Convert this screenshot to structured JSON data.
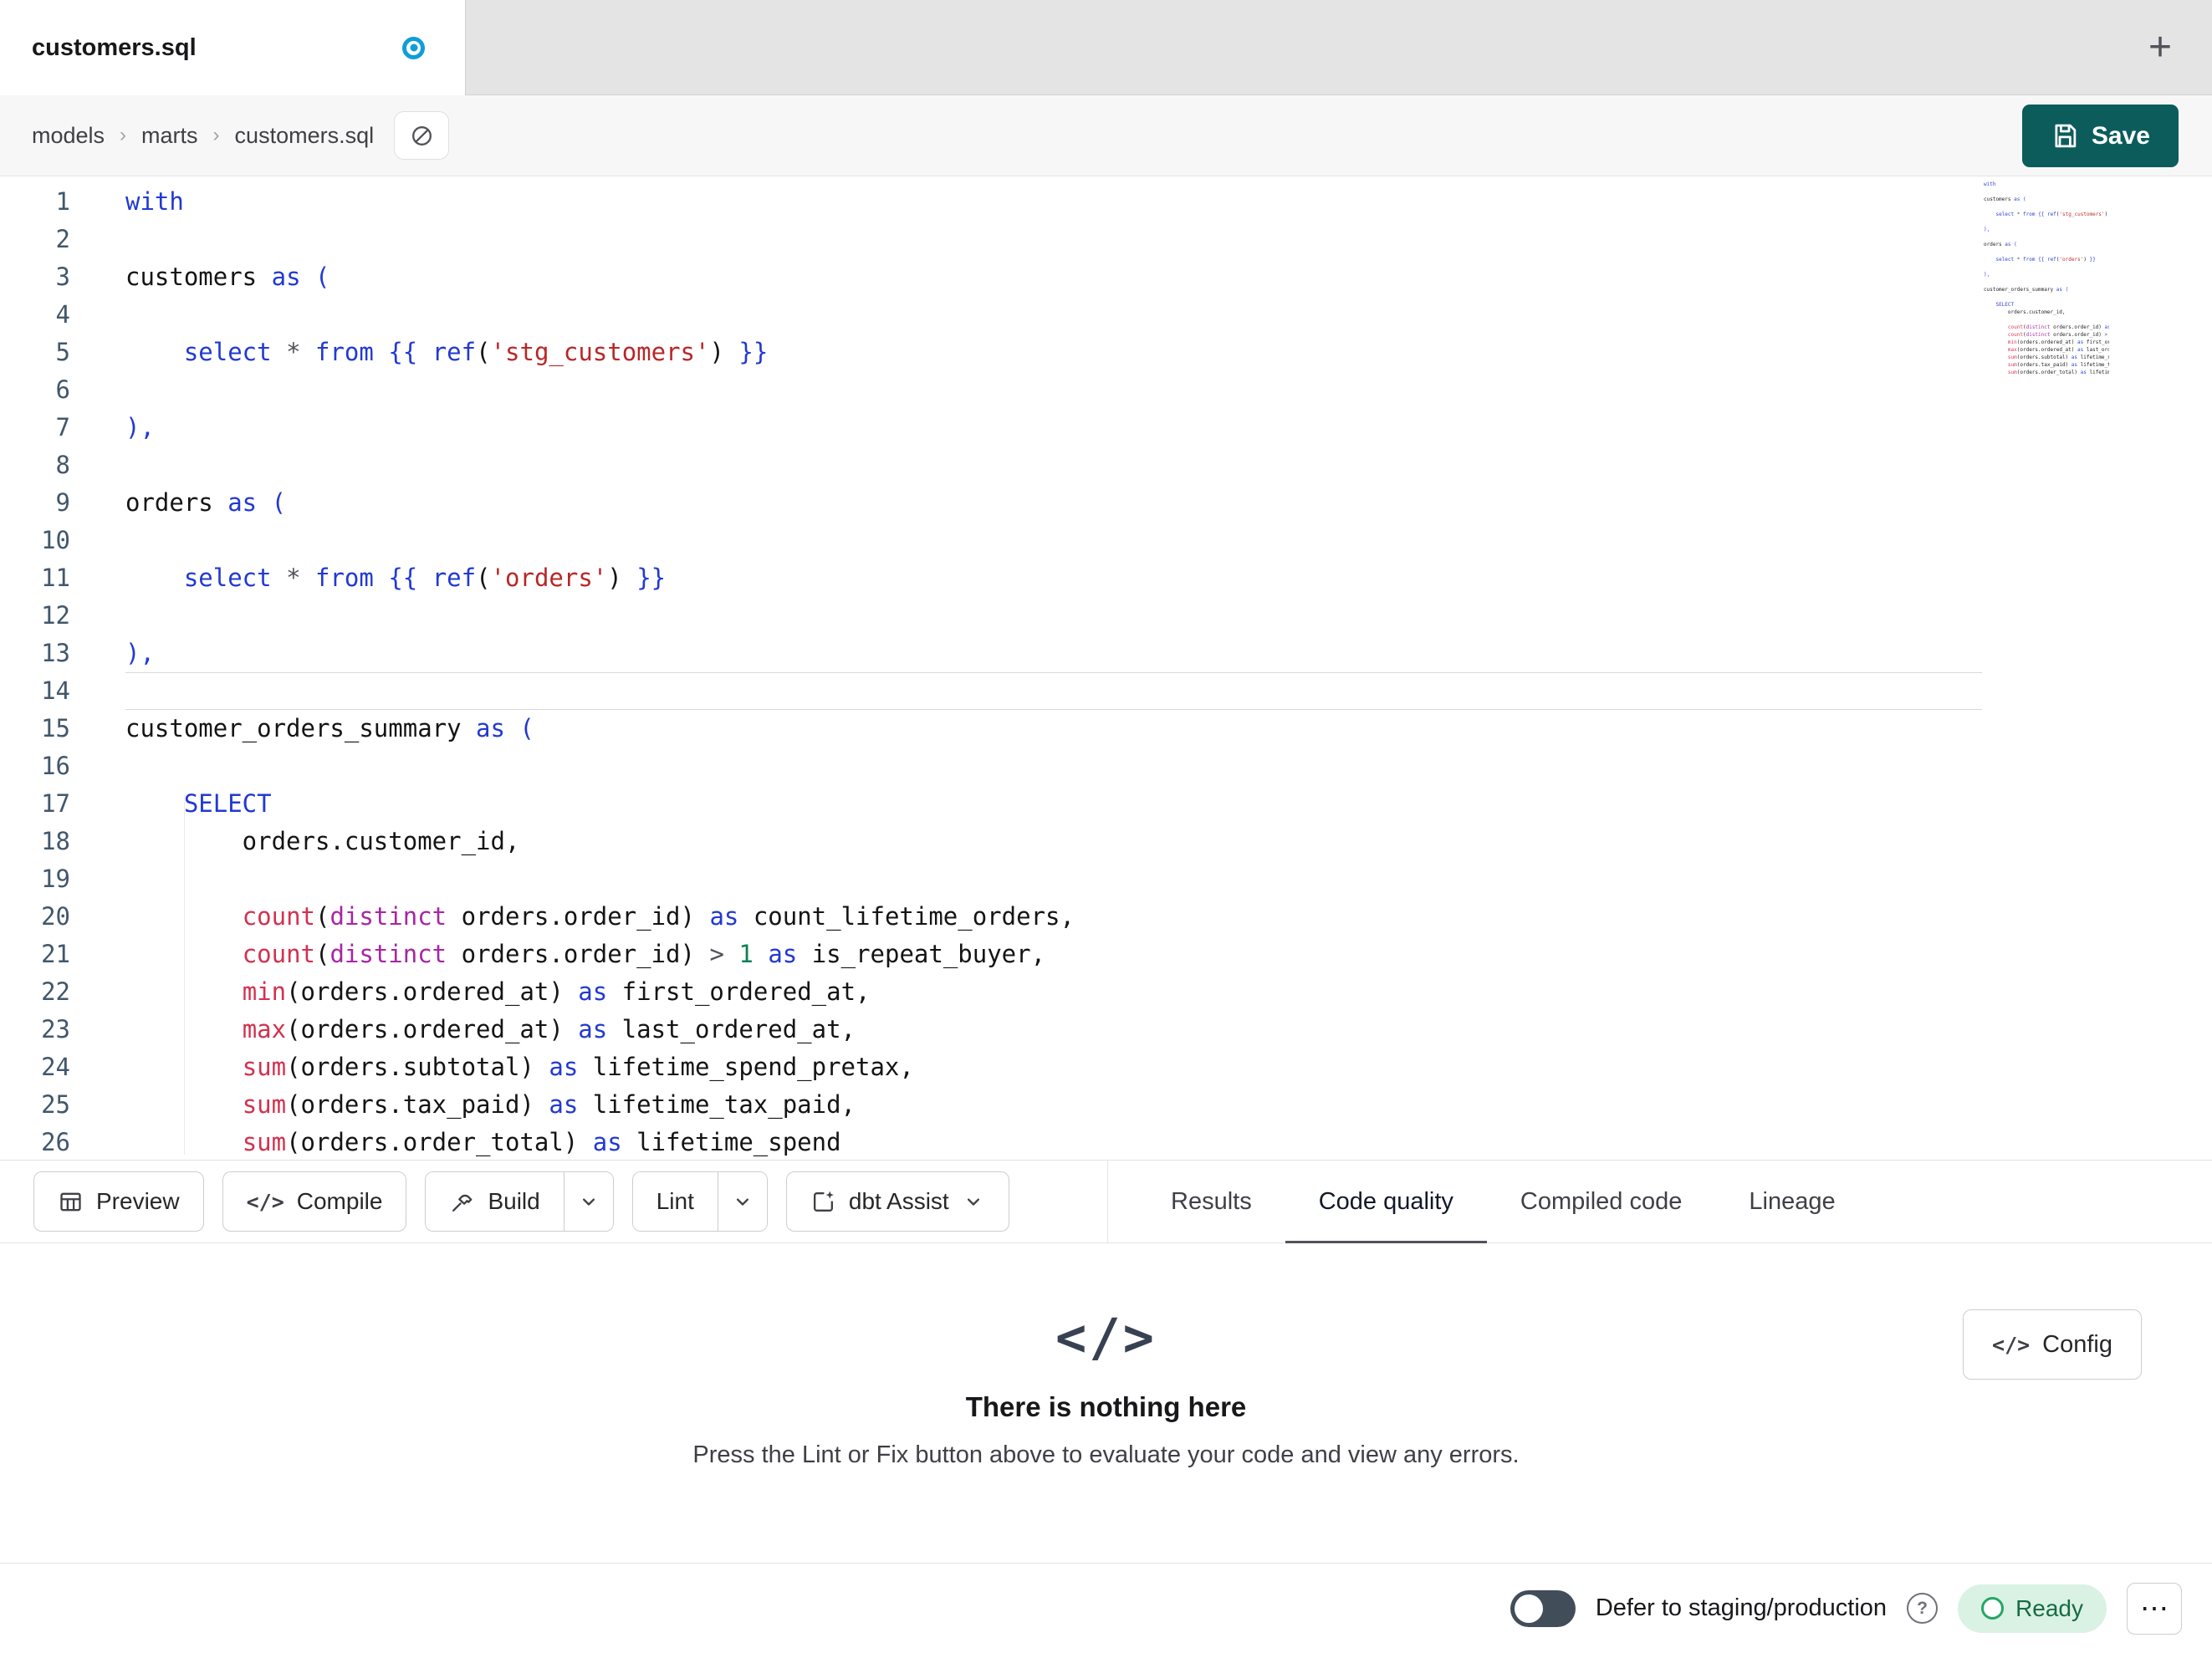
{
  "colors": {
    "kw": "#2239d2",
    "str": "#b82727",
    "fn": "#d23150",
    "kw2": "#a626a4",
    "num": "#0e8157",
    "op": "#52525b",
    "pl": "#141414",
    "lineno": "#41576b",
    "dot": "#0f9ed8",
    "save": "#0d5c5c",
    "ready-bg": "#d9f2e4",
    "ready-fg": "#186b43",
    "ready-ring": "#27a567",
    "toggle": "#414d59",
    "underline": "#52525b"
  },
  "tabbar": {
    "tab_label": "customers.sql",
    "new_tab": "+"
  },
  "breadcrumb": {
    "items": [
      "models",
      "marts",
      "customers.sql"
    ],
    "separator": "›"
  },
  "save": {
    "label": "Save"
  },
  "icons": {
    "code_glyph": "</>"
  },
  "editor": {
    "current_line": 14,
    "lines": [
      [
        [
          "with",
          "kw"
        ]
      ],
      [],
      [
        [
          "customers ",
          "pl"
        ],
        [
          "as",
          "kw"
        ],
        [
          " ",
          "pl"
        ],
        [
          "(",
          "kw"
        ]
      ],
      [],
      [
        [
          "    ",
          "pl"
        ],
        [
          "select",
          "kw"
        ],
        [
          " ",
          "pl"
        ],
        [
          "*",
          "op"
        ],
        [
          " ",
          "pl"
        ],
        [
          "from",
          "kw"
        ],
        [
          " ",
          "pl"
        ],
        [
          "{{",
          "kw"
        ],
        [
          " ",
          "pl"
        ],
        [
          "ref",
          "kw"
        ],
        [
          "(",
          "pl"
        ],
        [
          "'stg_customers'",
          "str"
        ],
        [
          ")",
          "pl"
        ],
        [
          " ",
          "pl"
        ],
        [
          "}}",
          "kw"
        ]
      ],
      [],
      [
        [
          "),",
          "kw"
        ]
      ],
      [],
      [
        [
          "orders ",
          "pl"
        ],
        [
          "as",
          "kw"
        ],
        [
          " ",
          "pl"
        ],
        [
          "(",
          "kw"
        ]
      ],
      [],
      [
        [
          "    ",
          "pl"
        ],
        [
          "select",
          "kw"
        ],
        [
          " ",
          "pl"
        ],
        [
          "*",
          "op"
        ],
        [
          " ",
          "pl"
        ],
        [
          "from",
          "kw"
        ],
        [
          " ",
          "pl"
        ],
        [
          "{{",
          "kw"
        ],
        [
          " ",
          "pl"
        ],
        [
          "ref",
          "kw"
        ],
        [
          "(",
          "pl"
        ],
        [
          "'orders'",
          "str"
        ],
        [
          ")",
          "pl"
        ],
        [
          " ",
          "pl"
        ],
        [
          "}}",
          "kw"
        ]
      ],
      [],
      [
        [
          "),",
          "kw"
        ]
      ],
      [],
      [
        [
          "customer_orders_summary ",
          "pl"
        ],
        [
          "as",
          "kw"
        ],
        [
          " ",
          "pl"
        ],
        [
          "(",
          "kw"
        ]
      ],
      [],
      [
        [
          "    ",
          "pl"
        ],
        [
          "SELECT",
          "kw"
        ]
      ],
      [
        [
          "        orders.customer_id,",
          "pl"
        ]
      ],
      [],
      [
        [
          "        ",
          "pl"
        ],
        [
          "count",
          "fn"
        ],
        [
          "(",
          "pl"
        ],
        [
          "distinct",
          "kw2"
        ],
        [
          " orders.order_id",
          "pl"
        ],
        [
          ")",
          "pl"
        ],
        [
          " ",
          "pl"
        ],
        [
          "as",
          "kw"
        ],
        [
          " count_lifetime_orders,",
          "pl"
        ]
      ],
      [
        [
          "        ",
          "pl"
        ],
        [
          "count",
          "fn"
        ],
        [
          "(",
          "pl"
        ],
        [
          "distinct",
          "kw2"
        ],
        [
          " orders.order_id",
          "pl"
        ],
        [
          ")",
          "pl"
        ],
        [
          " ",
          "pl"
        ],
        [
          ">",
          "op"
        ],
        [
          " ",
          "pl"
        ],
        [
          "1",
          "num"
        ],
        [
          " ",
          "pl"
        ],
        [
          "as",
          "kw"
        ],
        [
          " is_repeat_buyer,",
          "pl"
        ]
      ],
      [
        [
          "        ",
          "pl"
        ],
        [
          "min",
          "fn"
        ],
        [
          "(",
          "pl"
        ],
        [
          "orders.ordered_at",
          "pl"
        ],
        [
          ")",
          "pl"
        ],
        [
          " ",
          "pl"
        ],
        [
          "as",
          "kw"
        ],
        [
          " first_ordered_at,",
          "pl"
        ]
      ],
      [
        [
          "        ",
          "pl"
        ],
        [
          "max",
          "fn"
        ],
        [
          "(orders.ordered_at)",
          "pl"
        ],
        [
          " ",
          "pl"
        ],
        [
          "as",
          "kw"
        ],
        [
          " last_ordered_at,",
          "pl"
        ]
      ],
      [
        [
          "        ",
          "pl"
        ],
        [
          "sum",
          "fn"
        ],
        [
          "(orders.subtotal)",
          "pl"
        ],
        [
          " ",
          "pl"
        ],
        [
          "as",
          "kw"
        ],
        [
          " lifetime_spend_pretax,",
          "pl"
        ]
      ],
      [
        [
          "        ",
          "pl"
        ],
        [
          "sum",
          "fn"
        ],
        [
          "(orders.tax_paid)",
          "pl"
        ],
        [
          " ",
          "pl"
        ],
        [
          "as",
          "kw"
        ],
        [
          " lifetime_tax_paid,",
          "pl"
        ]
      ],
      [
        [
          "        ",
          "pl"
        ],
        [
          "sum",
          "fn"
        ],
        [
          "(orders.order_total)",
          "pl"
        ],
        [
          " ",
          "pl"
        ],
        [
          "as",
          "kw"
        ],
        [
          " lifetime_spend",
          "pl"
        ]
      ]
    ]
  },
  "toolbar": {
    "preview": "Preview",
    "compile": "Compile",
    "build": "Build",
    "lint": "Lint",
    "assist": "dbt Assist"
  },
  "panel_tabs": [
    {
      "label": "Results",
      "active": false
    },
    {
      "label": "Code quality",
      "active": true
    },
    {
      "label": "Compiled code",
      "active": false
    },
    {
      "label": "Lineage",
      "active": false
    }
  ],
  "empty_state": {
    "icon": "</>",
    "title": "There is nothing here",
    "message": "Press the Lint or Fix button above to evaluate your code and view any errors."
  },
  "config": {
    "icon": "</>",
    "label": "Config"
  },
  "status_bar": {
    "defer_label": "Defer to staging/production",
    "help": "?",
    "ready_label": "Ready",
    "menu": "⋯"
  }
}
